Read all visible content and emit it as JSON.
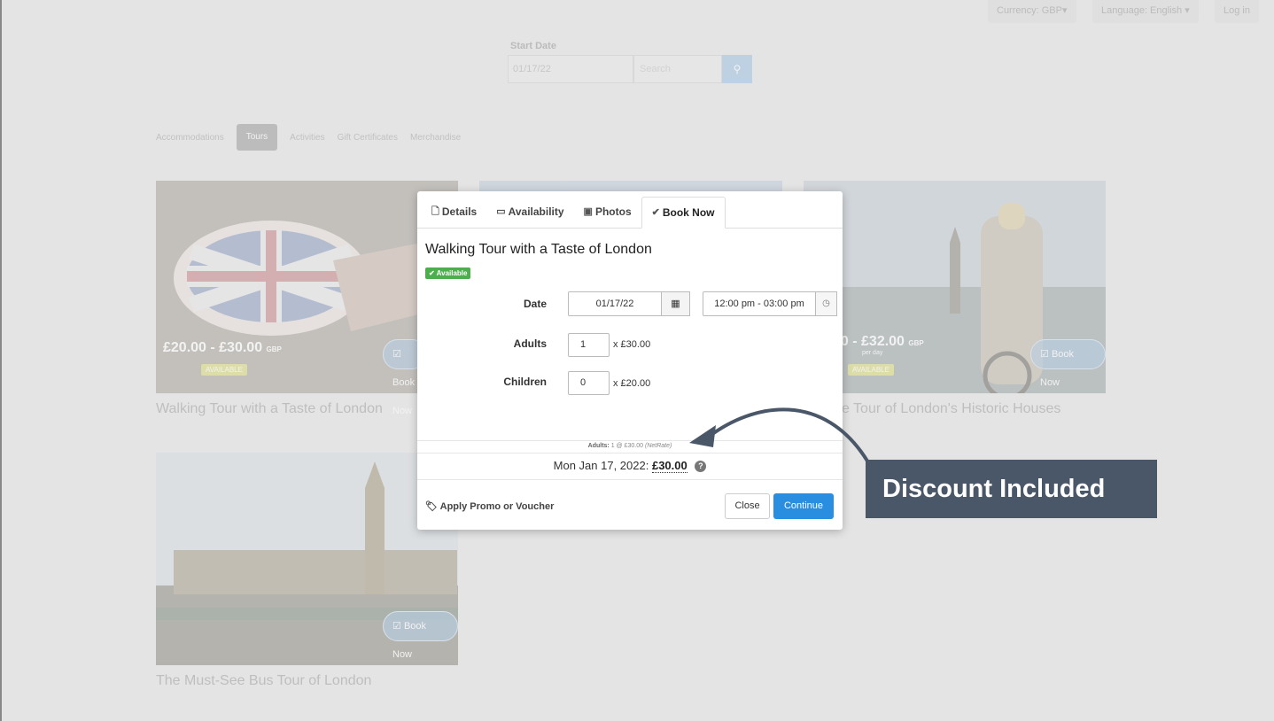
{
  "topbar": {
    "currency": "Currency: GBP",
    "language": "Language: English",
    "login": "Log in"
  },
  "search": {
    "start_date_label": "Start Date",
    "start_date_value": "01/17/22",
    "search_placeholder": "Search"
  },
  "categories": [
    {
      "label": "Accommodations",
      "active": false
    },
    {
      "label": "Tours",
      "active": true
    },
    {
      "label": "Activities",
      "active": false
    },
    {
      "label": "Gift Certificates",
      "active": false
    },
    {
      "label": "Merchandise",
      "active": false
    }
  ],
  "cards": [
    {
      "title": "Walking Tour with a Taste of London",
      "price": "£20.00 - £30.00",
      "currency": "GBP",
      "status": "AVAILABLE",
      "button": "Book Now"
    },
    {
      "title": "e Tour of London's Historic Houses",
      "price": "00 - £32.00",
      "currency": "GBP",
      "sub": "per day",
      "status": "AVAILABLE",
      "button": "Book Now"
    },
    {
      "title": "The Must-See Bus Tour of London",
      "button": "Book Now"
    }
  ],
  "modal": {
    "tabs": [
      {
        "label": "Details",
        "icon": "file-icon"
      },
      {
        "label": "Availability",
        "icon": "calendar-icon"
      },
      {
        "label": "Photos",
        "icon": "image-icon"
      },
      {
        "label": "Book Now",
        "icon": "check-icon",
        "active": true
      }
    ],
    "title": "Walking Tour with a Taste of London",
    "badge": "Available",
    "date_label": "Date",
    "date_value": "01/17/22",
    "time_value": "12:00 pm - 03:00 pm",
    "adults_label": "Adults",
    "adults_qty": "1",
    "adults_price": "x £30.00",
    "children_label": "Children",
    "children_qty": "0",
    "children_price": "x £20.00",
    "netrate_label": "Adults:",
    "netrate_value": "1 @ £30.00",
    "netrate_note": "(NetRate)",
    "total_date": "Mon Jan 17, 2022:",
    "total_amount": "£30.00",
    "promo": "Apply Promo or Voucher",
    "close": "Close",
    "continue": "Continue"
  },
  "callout": "Discount Included",
  "colors": {
    "primary": "#2a8ee0",
    "success": "#4cae4c",
    "callout_bg": "#4a5768"
  }
}
